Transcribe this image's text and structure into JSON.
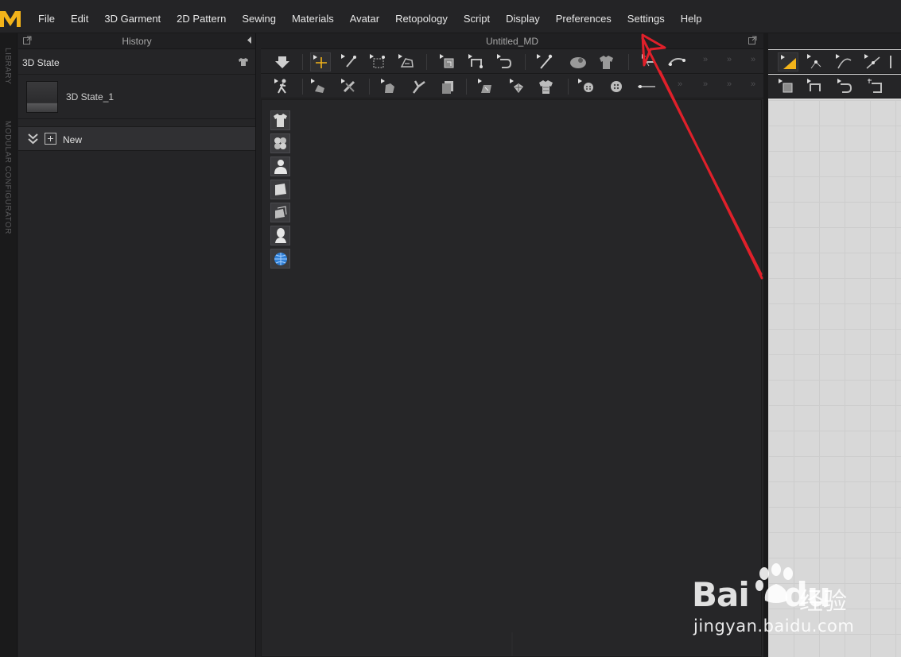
{
  "menubar": {
    "items": [
      "File",
      "Edit",
      "3D Garment",
      "2D Pattern",
      "Sewing",
      "Materials",
      "Avatar",
      "Retopology",
      "Script",
      "Display",
      "Preferences",
      "Settings",
      "Help"
    ]
  },
  "left_strip": {
    "library_label": "LIBRARY",
    "modular_label": "MODULAR CONFIGURATOR"
  },
  "history": {
    "title": "History",
    "section_label": "3D State",
    "state_item": "3D State_1",
    "new_label": "New"
  },
  "viewport_3d": {
    "title": "Untitled_MD"
  },
  "colors": {
    "accent": "#f2b31a",
    "annotation": "#e0202a"
  },
  "watermark": {
    "brand": "Bai",
    "brand_suffix": "du",
    "chinese": "经验",
    "url": "jingyan.baidu.com"
  }
}
